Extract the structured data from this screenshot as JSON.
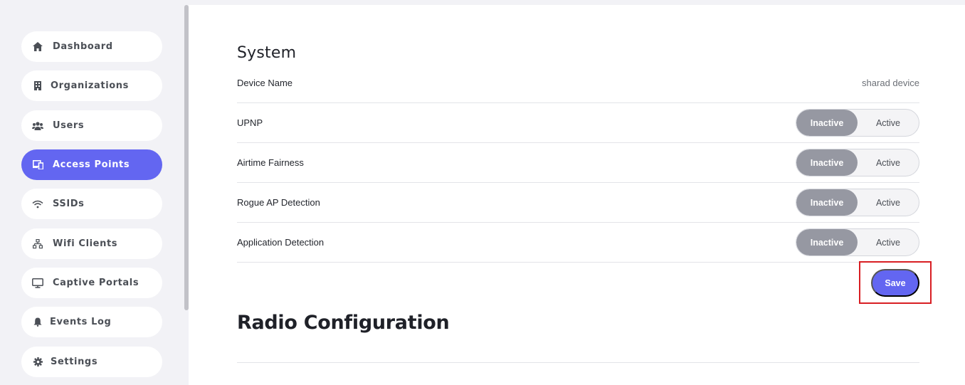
{
  "sidebar": {
    "items": [
      {
        "label": "Dashboard",
        "icon": "home-icon",
        "active": false
      },
      {
        "label": "Organizations",
        "icon": "building-icon",
        "active": false
      },
      {
        "label": "Users",
        "icon": "users-icon",
        "active": false
      },
      {
        "label": "Access Points",
        "icon": "devices-icon",
        "active": true
      },
      {
        "label": "SSIDs",
        "icon": "wifi-icon",
        "active": false
      },
      {
        "label": "Wifi Clients",
        "icon": "network-icon",
        "active": false
      },
      {
        "label": "Captive Portals",
        "icon": "monitor-icon",
        "active": false
      },
      {
        "label": "Events Log",
        "icon": "bell-icon",
        "active": false
      },
      {
        "label": "Settings",
        "icon": "gear-icon",
        "active": false
      }
    ]
  },
  "system": {
    "title": "System",
    "device_name_label": "Device Name",
    "device_name_value": "sharad device",
    "toggles": [
      {
        "label": "UPNP",
        "selected": "Inactive"
      },
      {
        "label": "Airtime Fairness",
        "selected": "Inactive"
      },
      {
        "label": "Rogue AP Detection",
        "selected": "Inactive"
      },
      {
        "label": "Application Detection",
        "selected": "Inactive"
      }
    ],
    "inactive_label": "Inactive",
    "active_label": "Active",
    "save_label": "Save"
  },
  "radio": {
    "title": "Radio Configuration"
  },
  "colors": {
    "accent": "#6366f1",
    "toggle_selected": "#9698a2",
    "highlight_border": "#d81e23",
    "sidebar_bg": "#f2f2f6"
  }
}
